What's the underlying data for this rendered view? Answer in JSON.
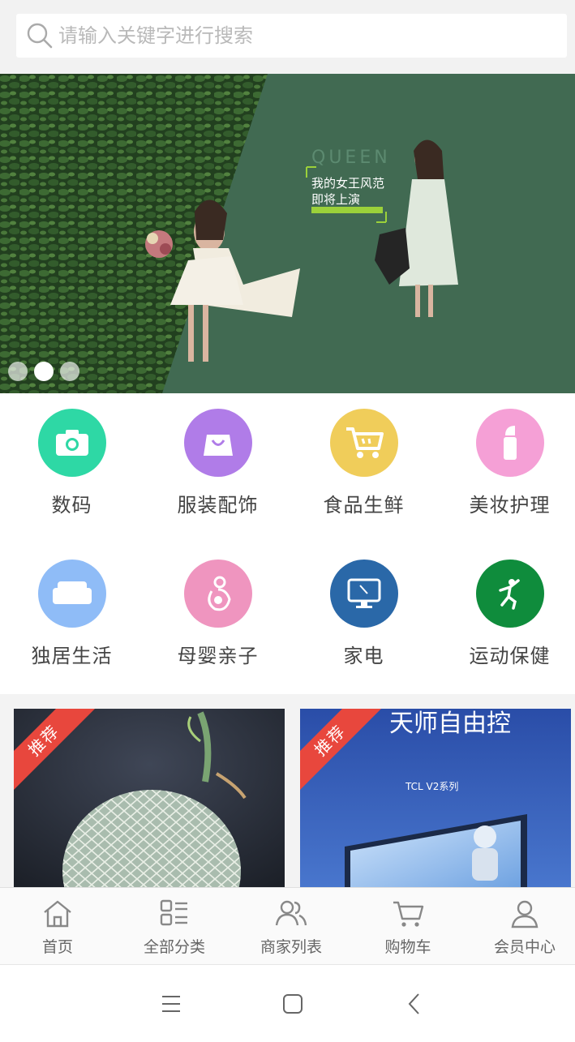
{
  "search": {
    "placeholder": "请输入关键字进行搜索"
  },
  "banner": {
    "headline_1": "我的女王风范",
    "headline_2": "即将上演",
    "word": "QUEEN",
    "active_dot": 1
  },
  "categories": [
    {
      "label": "数码",
      "icon": "camera-icon",
      "color": "#2ed8a5"
    },
    {
      "label": "服装配饰",
      "icon": "shopping-bag-icon",
      "color": "#b07ce8"
    },
    {
      "label": "食品生鲜",
      "icon": "shopping-cart-icon",
      "color": "#f0cd5a"
    },
    {
      "label": "美妆护理",
      "icon": "lipstick-icon",
      "color": "#f5a0d6"
    },
    {
      "label": "独居生活",
      "icon": "sofa-icon",
      "color": "#8fbcf7"
    },
    {
      "label": "母婴亲子",
      "icon": "mother-baby-icon",
      "color": "#ef95bf"
    },
    {
      "label": "家电",
      "icon": "monitor-icon",
      "color": "#2a68a8"
    },
    {
      "label": "运动保健",
      "icon": "runner-icon",
      "color": "#0f8c3c"
    }
  ],
  "products": [
    {
      "tag": "推荐",
      "image": "melon-photo"
    },
    {
      "tag": "推荐",
      "image": "tv-promo",
      "tv_text": "TCL V2系列",
      "headline": "天师自由控"
    }
  ],
  "tabs": [
    {
      "label": "首页",
      "icon": "home-icon"
    },
    {
      "label": "全部分类",
      "icon": "category-grid-icon"
    },
    {
      "label": "商家列表",
      "icon": "merchants-icon"
    },
    {
      "label": "购物车",
      "icon": "cart-icon"
    },
    {
      "label": "会员中心",
      "icon": "user-icon"
    }
  ],
  "system_nav": [
    "menu-icon",
    "home-square-icon",
    "back-icon"
  ]
}
